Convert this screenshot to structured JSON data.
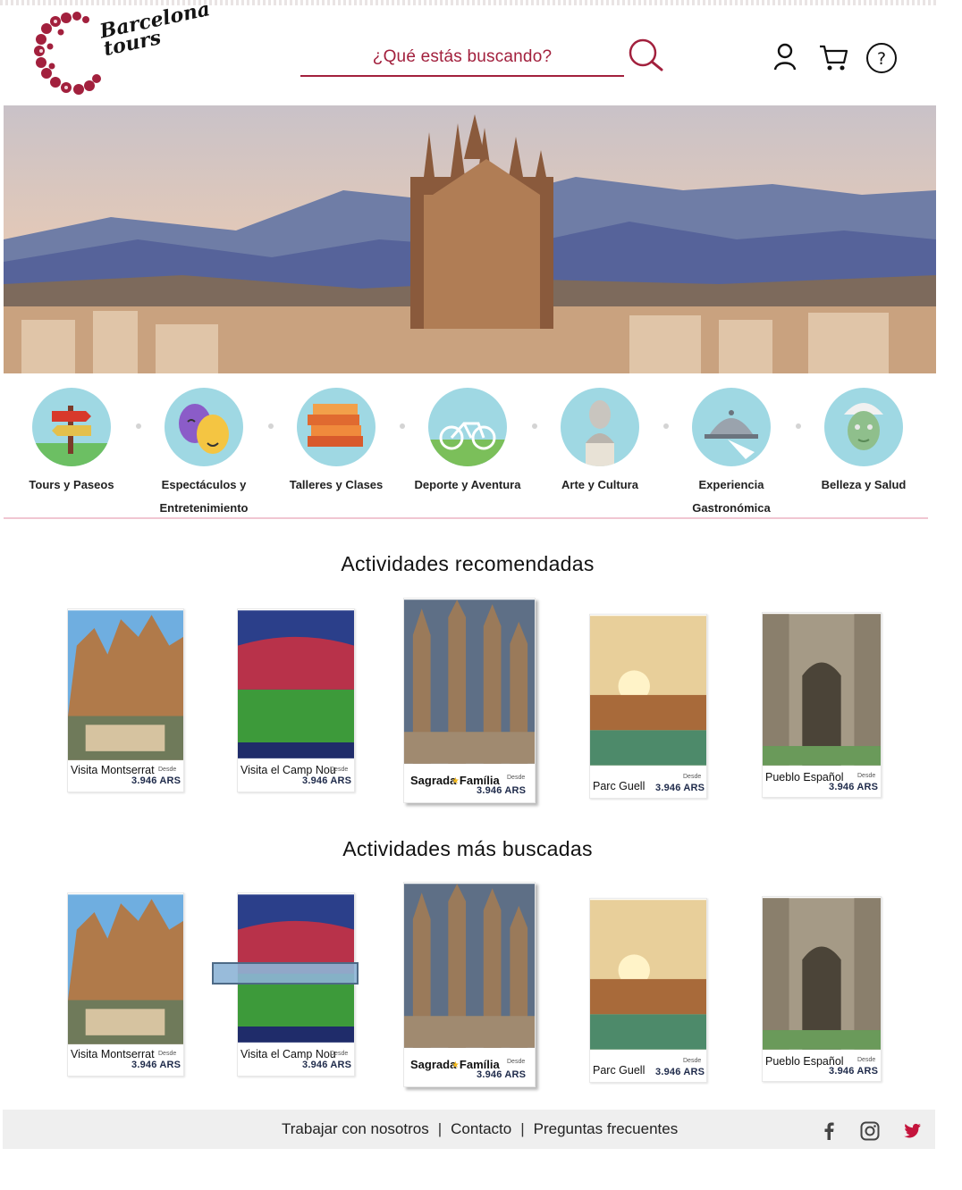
{
  "brand": {
    "name_line1": "Barcelona",
    "name_line2": "tours",
    "color": "#a2203d"
  },
  "header": {
    "search_placeholder": "¿Qué estás buscando?",
    "icons": [
      "search-icon",
      "user-icon",
      "cart-icon",
      "help-icon"
    ]
  },
  "categories": [
    {
      "label": "Tours y Paseos",
      "icon": "signpost-icon"
    },
    {
      "label": "Espectáculos y Entretenimiento",
      "icon": "theater-masks-icon"
    },
    {
      "label": "Talleres y Clases",
      "icon": "books-icon"
    },
    {
      "label": "Deporte y Aventura",
      "icon": "bicycle-icon"
    },
    {
      "label": "Arte y Cultura",
      "icon": "bust-statue-icon"
    },
    {
      "label": "Experiencia Gastronómica",
      "icon": "cloche-icon"
    },
    {
      "label": "Belleza y Salud",
      "icon": "face-mask-icon"
    }
  ],
  "sections": {
    "recommended_title": "Actividades recomendadas",
    "most_searched_title": "Actividades más buscadas"
  },
  "cards": [
    {
      "name": "Visita Montserrat",
      "desde": "Desde",
      "price": "3.946 ARS"
    },
    {
      "name": "Visita el Camp Nou",
      "desde": "Desde",
      "price": "3.946 ARS"
    },
    {
      "name": "Sagrada Família",
      "desde": "Desde",
      "price": "3.946 ARS"
    },
    {
      "name": "Parc Guell",
      "desde": "Desde",
      "price": "3.946 ARS"
    },
    {
      "name": "Pueblo Español",
      "desde": "Desde",
      "price": "3.946 ARS"
    }
  ],
  "footer": {
    "links": [
      "Trabajar con nosotros",
      "Contacto",
      "Preguntas frecuentes"
    ],
    "separator": "|",
    "social": [
      "facebook-icon",
      "instagram-icon",
      "twitter-icon"
    ],
    "twitter_color": "#c4143c"
  }
}
